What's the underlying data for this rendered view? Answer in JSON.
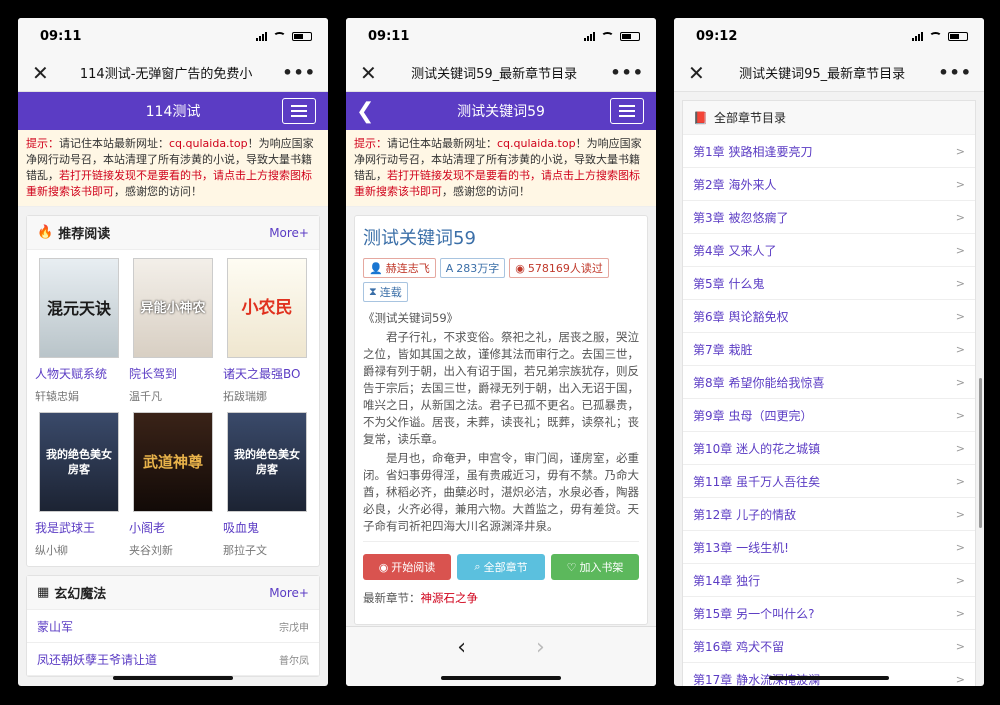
{
  "phone1": {
    "time": "09:11",
    "title": "114测试-无弹窗广告的免费小",
    "nav_title": "114测试",
    "notice": {
      "label": "提示：",
      "text1": "请记住本站最新网址：",
      "url": "cq.qulaida.top",
      "text2": "！为响应国家净网行动号召，本站清理了所有涉黄的小说，导致大量书籍错乱，",
      "red": "若打开链接发现不是要看的书，请点击上方搜索图标重新搜索该书即可",
      "text3": "，感谢您的访问！"
    },
    "recommend": {
      "heading": "推荐阅读",
      "more": "More+",
      "books": [
        {
          "cover": "混元天诀",
          "title": "人物天赋系统",
          "author": "轩辕忠娟"
        },
        {
          "cover": "异能小神农",
          "title": "院长驾到",
          "author": "温千凡"
        },
        {
          "cover": "小农民",
          "title": "诸天之最强BO",
          "author": "拓跋瑞娜"
        },
        {
          "cover": "我的绝色美女房客",
          "title": "我是武球王",
          "author": "纵小柳"
        },
        {
          "cover": "武道神尊",
          "title": "小阁老",
          "author": "夹谷刘新"
        },
        {
          "cover": "我的绝色美女房客",
          "title": "吸血鬼",
          "author": "那拉子文"
        }
      ]
    },
    "fantasy": {
      "heading": "玄幻魔法",
      "more": "More+",
      "items": [
        {
          "title": "蒙山军",
          "author": "宗戊申"
        },
        {
          "title": "凤还朝妖孽王爷请让道",
          "author": "普尔凤"
        }
      ]
    }
  },
  "phone2": {
    "time": "09:11",
    "title": "测试关键词59_最新章节目录",
    "nav_title": "测试关键词59",
    "notice": {
      "label": "提示：",
      "text1": "请记住本站最新网址：",
      "url": "cq.qulaida.top",
      "text2": "！为响应国家净网行动号召，本站清理了所有涉黄的小说，导致大量书籍错乱，",
      "red": "若打开链接发现不是要看的书，请点击上方搜索图标重新搜索该书即可",
      "text3": "，感谢您的访问！"
    },
    "book": {
      "title": "测试关键词59",
      "author": "赫连志飞",
      "words": "283万字",
      "reads": "578169人读过",
      "status": "连载",
      "intro_title": "《测试关键词59》",
      "para1": "君子行礼，不求变俗。祭祀之礼，居丧之服，哭泣之位，皆如其国之故，谨修其法而审行之。去国三世，爵禄有列于朝，出入有诏于国，若兄弟宗族犹存，则反告于宗后；去国三世，爵禄无列于朝，出入无诏于国，唯兴之日，从新国之法。君子已孤不更名。已孤暴贵，不为父作谥。居丧，未葬，读丧礼；既葬，读祭礼；丧复常，读乐章。",
      "para2": "是月也，命奄尹，申宫令，审门闾，谨房室，必重闭。省妇事毋得淫，虽有贵戚近习，毋有不禁。乃命大酋，秫稻必齐，曲蘖必时，湛炽必洁，水泉必香，陶器必良，火齐必得，兼用六物。大酋监之，毋有差贷。天子命有司祈祀四海大川名源渊泽井泉。",
      "btn_read": "开始阅读",
      "btn_all": "全部章节",
      "btn_shelf": "加入书架",
      "latest_label": "最新章节：",
      "latest": "神源石之争"
    }
  },
  "phone3": {
    "time": "09:12",
    "title": "测试关键词95_最新章节目录",
    "heading": "全部章节目录",
    "chapters": [
      "第1章 狭路相逢要亮刀",
      "第2章 海外来人",
      "第3章 被忽悠瘸了",
      "第4章 又来人了",
      "第5章 什么鬼",
      "第6章 舆论豁免权",
      "第7章 栽脏",
      "第8章 希望你能给我惊喜",
      "第9章 虫母（四更完）",
      "第10章 迷人的花之城镇",
      "第11章 虽千万人吾往矣",
      "第12章 儿子的情敌",
      "第13章 一线生机!",
      "第14章 独行",
      "第15章 另一个叫什么?",
      "第16章 鸡犬不留",
      "第17章 静水流深掩波澜"
    ]
  }
}
